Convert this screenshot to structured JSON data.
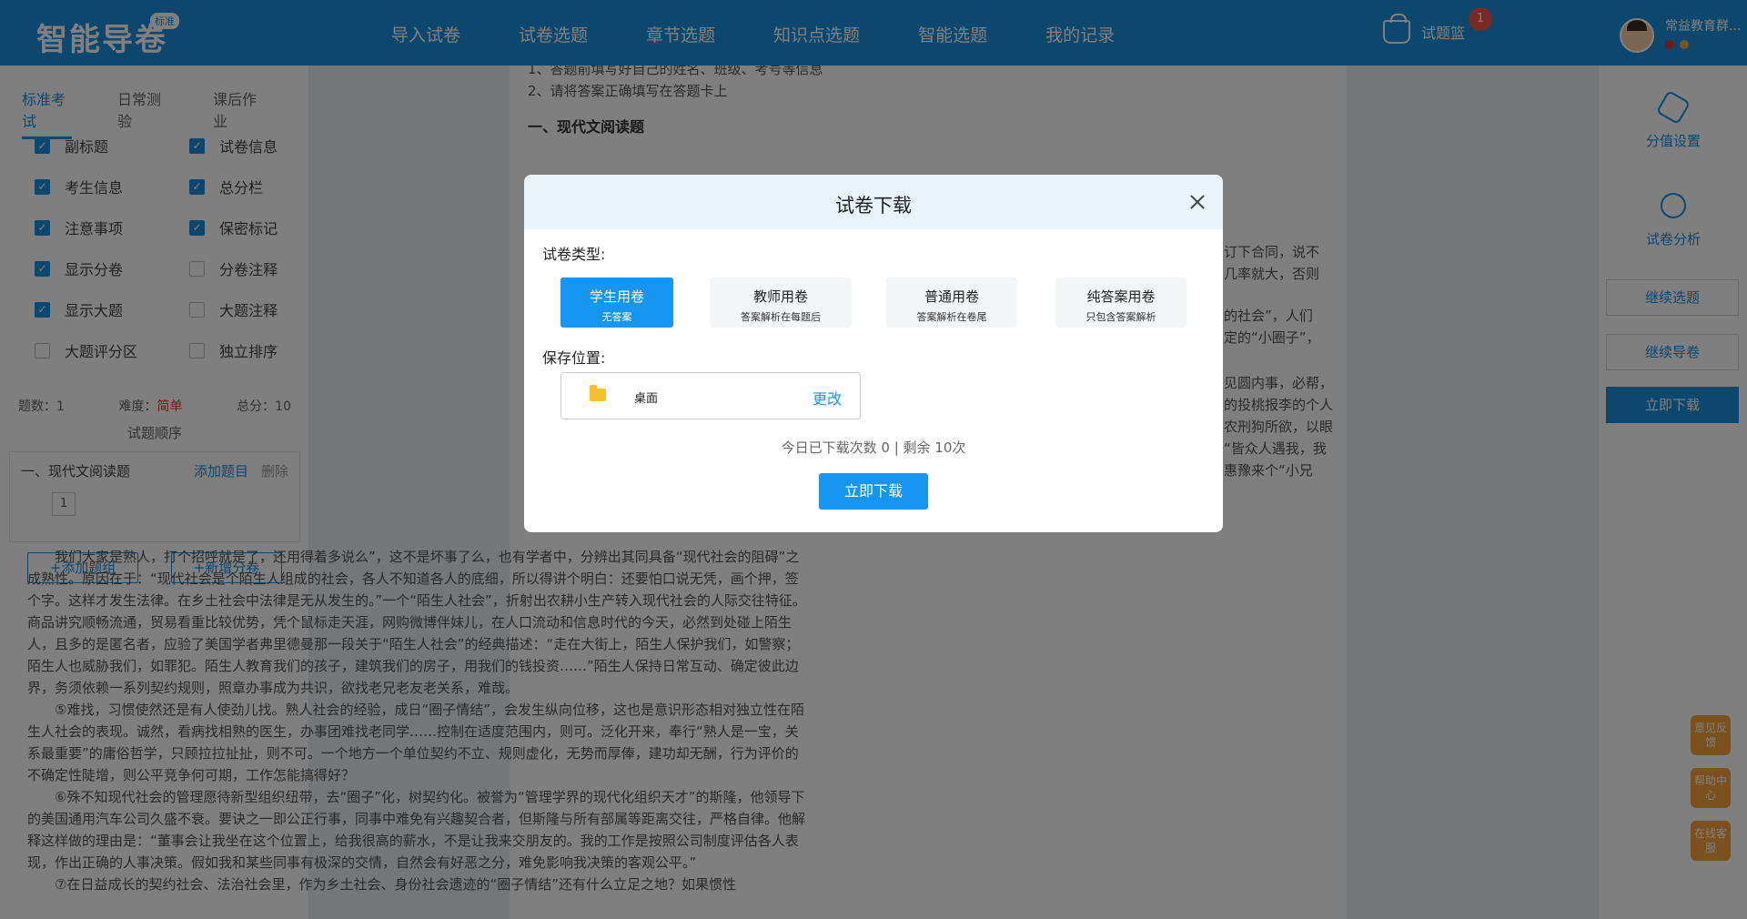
{
  "header": {
    "logo": "智能导卷",
    "logo_badge": "标准",
    "nav": [
      "导入试卷",
      "试卷选题",
      "章节选题",
      "知识点选题",
      "智能选题",
      "我的记录"
    ],
    "basket_label": "试题篮",
    "basket_count": "1",
    "user_name": "常益教育群..."
  },
  "left": {
    "tabs": [
      "标准考试",
      "日常测验",
      "课后作业"
    ],
    "options": [
      {
        "label": "副标题",
        "checked": true
      },
      {
        "label": "试卷信息",
        "checked": true
      },
      {
        "label": "考生信息",
        "checked": true
      },
      {
        "label": "总分栏",
        "checked": true
      },
      {
        "label": "注意事项",
        "checked": true
      },
      {
        "label": "保密标记",
        "checked": true
      },
      {
        "label": "显示分卷",
        "checked": true
      },
      {
        "label": "分卷注释",
        "checked": false
      },
      {
        "label": "显示大题",
        "checked": true
      },
      {
        "label": "大题注释",
        "checked": false
      },
      {
        "label": "大题评分区",
        "checked": false
      },
      {
        "label": "独立排序",
        "checked": false
      }
    ],
    "stats": {
      "count": "题数：1",
      "difficulty_label": "难度：",
      "difficulty_value": "简单",
      "score": "总分：10"
    },
    "order_title": "试题顺序",
    "section": {
      "title": "一、现代文阅读题",
      "add": "添加题目",
      "delete": "删除",
      "number": "1"
    },
    "buttons": [
      "+添加题组",
      "+新增分卷"
    ]
  },
  "doc": {
    "lines": [
      "1、答题前填写好自己的姓名、班级、考号等信息",
      "2、请将答案正确填写在答题卡上"
    ],
    "heading": "一、现代文阅读题",
    "fragments": [
      "签订下合同，说不",
      "用几率就大，否则",
      "人的社会”，人们",
      "之定的“小圈子”，",
      "。见圆内事，必帮，",
      "事的投桃报李的个人",
      "恋农刑狗所欲，以眼",
      "于“皆众人遇我，我",
      "从惠豫来个“小兄"
    ],
    "paragraphs": [
      "我们大家是熟人，打个招呼就是了，还用得着多说么”，这不是坏事了么，也有学者中，分辨出其同具备“现代社会的阻碍”之成熟性。原因在于：“现代社会是个陌生人组成的社会，各人不知道各人的底细，所以得讲个明白：还要怕口说无凭，画个押，签个字。这样才发生法律。在乡土社会中法律是无从发生的。”一个“陌生人社会”，折射出农耕小生产转入现代社会的人际交往特征。商品讲究顺畅流通，贸易看重比较优势，凭个鼠标走天涯，网购微博伴妹儿，在人口流动和信息时代的今天，必然到处碰上陌生人，且多的是匿名者，应验了美国学者弗里德曼那一段关于“陌生人社会”的经典描述：“走在大街上，陌生人保护我们，如警察；陌生人也威胁我们，如罪犯。陌生人教育我们的孩子，建筑我们的房子，用我们的钱投资……”陌生人保持日常互动、确定彼此边界，务须依赖一系列契约规则，照章办事成为共识，欲找老兄老友老关系，难哉。",
      "⑤难找，习惯使然还是有人使劲儿找。熟人社会的经验，成日“圈子情结”，会发生纵向位移，这也是意识形态相对独立性在陌生人社会的表现。诚然，看病找相熟的医生，办事团难找老同学……控制在适度范围内，则可。泛化开来，奉行“熟人是一宝，关系最重要”的庸俗哲学，只顾拉拉扯扯，则不可。一个地方一个单位契约不立、规则虚化，无势而厚俸，建功却无酬，行为评价的不确定性陡增，则公平竞争何可期，工作怎能搞得好？",
      "⑥殊不知现代社会的管理愿待新型组织纽带，去“圈子”化，树契约化。被誉为“管理学界的现代化组织天才”的斯隆，他领导下的美国通用汽车公司久盛不衰。要诀之一即公正行事，同事中难免有兴趣契合者，但斯隆与所有部属等距离交往，严格自律。他解释这样做的理由是：“董事会让我坐在这个位置上，给我很高的薪水，不是让我来交朋友的。我的工作是按照公司制度评估各人表现，作出正确的人事决策。假如我和某些同事有极深的交情，自然会有好恶之分，难免影响我决策的客观公平。”",
      "⑦在日益成长的契约社会、法治社会里，作为乡土社会、身份社会遗迹的“圈子情结”还有什么立足之地？如果惯性"
    ]
  },
  "right": {
    "items": [
      "分值设置",
      "试卷分析"
    ],
    "buttons": [
      "继续选题",
      "继续导卷"
    ],
    "download": "立即下载",
    "floats": [
      "意见反馈",
      "帮助中心",
      "在线客服"
    ]
  },
  "modal": {
    "title": "试卷下载",
    "type_label": "试卷类型:",
    "types": [
      {
        "name": "学生用卷",
        "desc": "无答案",
        "active": true
      },
      {
        "name": "教师用卷",
        "desc": "答案解析在每题后",
        "active": false
      },
      {
        "name": "普通用卷",
        "desc": "答案解析在卷尾",
        "active": false
      },
      {
        "name": "纯答案用卷",
        "desc": "只包含答案解析",
        "active": false
      }
    ],
    "save_label": "保存位置:",
    "save_location": "桌面",
    "change": "更改",
    "quota": "今日已下载次数 0 | 剩余 10次",
    "download": "立即下载"
  },
  "colors": {
    "primary": "#1b8fdb",
    "modal_accent": "#1696f0",
    "danger": "#e0382e",
    "float": "#f6a33d"
  }
}
